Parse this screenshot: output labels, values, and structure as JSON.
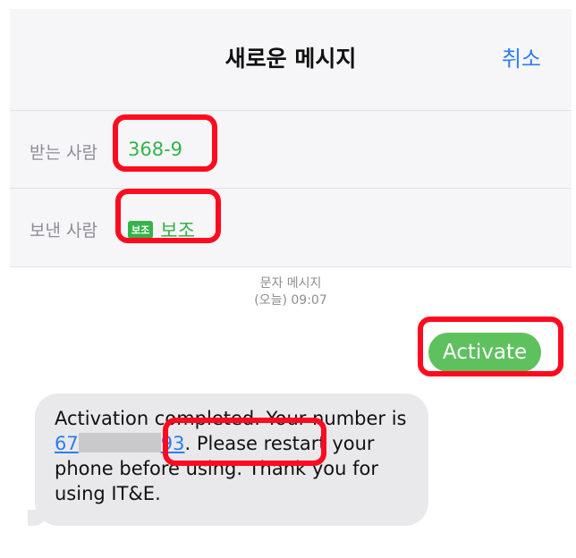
{
  "header": {
    "title": "새로운 메시지",
    "cancel": "취소"
  },
  "to": {
    "label": "받는 사람",
    "value": "368-9"
  },
  "from": {
    "label": "보낸 사람",
    "badge": "보조",
    "value": "보조"
  },
  "conversation": {
    "date_line1": "문자 메시지",
    "date_line2": "(오늘) 09:07",
    "outgoing": "Activate",
    "incoming": {
      "before": "Activation completed. Your number is ",
      "number_start": "67",
      "number_end": "93",
      "after": ". Please restart your phone before using. Thank you for using IT&E."
    }
  },
  "colors": {
    "accent_blue": "#2a7df2",
    "green": "#34b34a",
    "highlight_red": "#ff0a1f"
  }
}
